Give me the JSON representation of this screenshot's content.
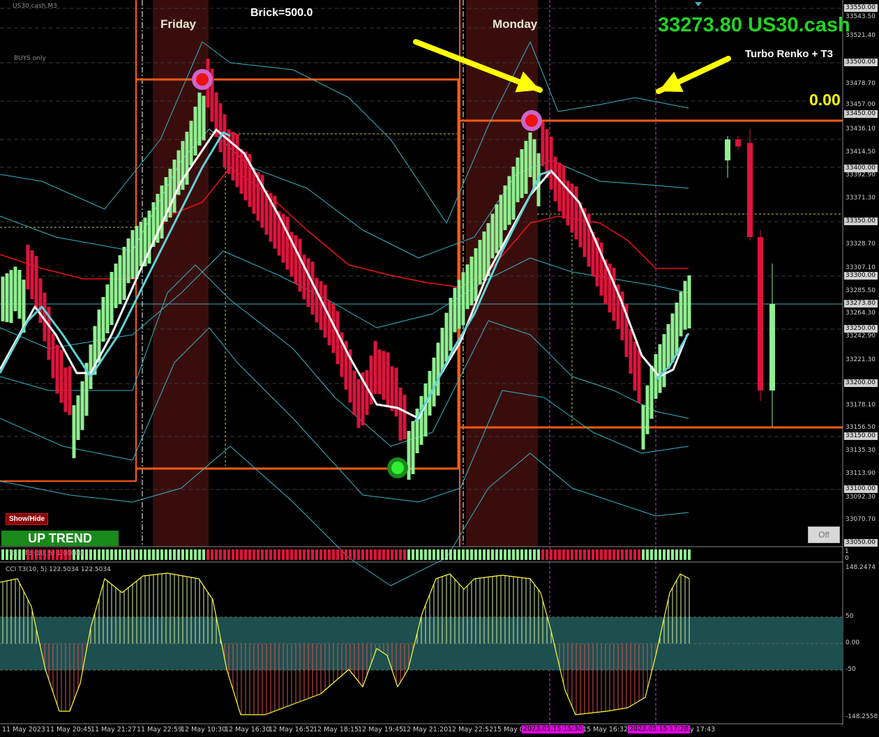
{
  "window": {
    "title": "US30.cash,M3"
  },
  "panel_labels": {
    "buys_only": "BUYS only"
  },
  "overlays": {
    "brick": "Brick=500.0",
    "day_labels": [
      "Friday",
      "Monday"
    ],
    "symbol_price": "33273.80 US30.cash",
    "indicator_name": "Turbo Renko + T3",
    "indicator_value": "0.00"
  },
  "controls": {
    "show_hide": "Show/Hide",
    "trend": "UP TREND",
    "off": "Off"
  },
  "subwindows": {
    "bar_indicator_label": "TC... T3 (10, 5) 1.00000",
    "bar_scale": [
      "1",
      "0"
    ],
    "cci_label": "CCI T3(10, 5) 122.5034 122.5034"
  },
  "price_axis": {
    "ticks": [
      "33543.50",
      "33521.40",
      "33478.70",
      "33457.00",
      "33436.10",
      "33414.50",
      "33392.90",
      "33371.30",
      "33328.70",
      "33307.10",
      "33285.50",
      "33264.30",
      "33242.90",
      "33221.30",
      "33178.10",
      "33156.50",
      "33135.30",
      "33113.90",
      "33092.30",
      "33070.70"
    ],
    "boxes": [
      "33550.00",
      "33500.00",
      "33450.00",
      "33400.00",
      "33350.00",
      "33300.00",
      "33273.80",
      "33250.00",
      "33200.00",
      "33150.00",
      "33100.00",
      "33050.00"
    ]
  },
  "cci_axis": {
    "ticks": [
      "148.2474",
      "50",
      "0.00",
      "-50",
      "-148.2558"
    ]
  },
  "time_axis": {
    "ticks": [
      "11 May 2023",
      "11 May 20:45",
      "11 May 21:27",
      "11 May 22:59",
      "12 May 10:30",
      "12 May 16:30",
      "12 May 16:52",
      "12 May 18:15",
      "12 May 19:45",
      "12 May 21:20",
      "12 May 22:52",
      "15 May 0",
      "15 May 16:32",
      "May 17:43"
    ],
    "highlight": [
      "2023.05.15 15:30",
      "2023.05.15 17:28"
    ]
  },
  "colors": {
    "bull": "#90ee90",
    "bear": "#dc143c",
    "t3_fast": "#ffffff",
    "t3_slow": "#5fd3d8",
    "orange": "#ff5a14",
    "band": "#33b5c8",
    "midband": "#ee1111",
    "session": "#3a0d0d",
    "cci_bg": "#1d4f4f",
    "arrow": "#ffff00"
  },
  "icons": [
    "signal-top-icon",
    "signal-bottom-icon",
    "arrow-icon"
  ]
}
